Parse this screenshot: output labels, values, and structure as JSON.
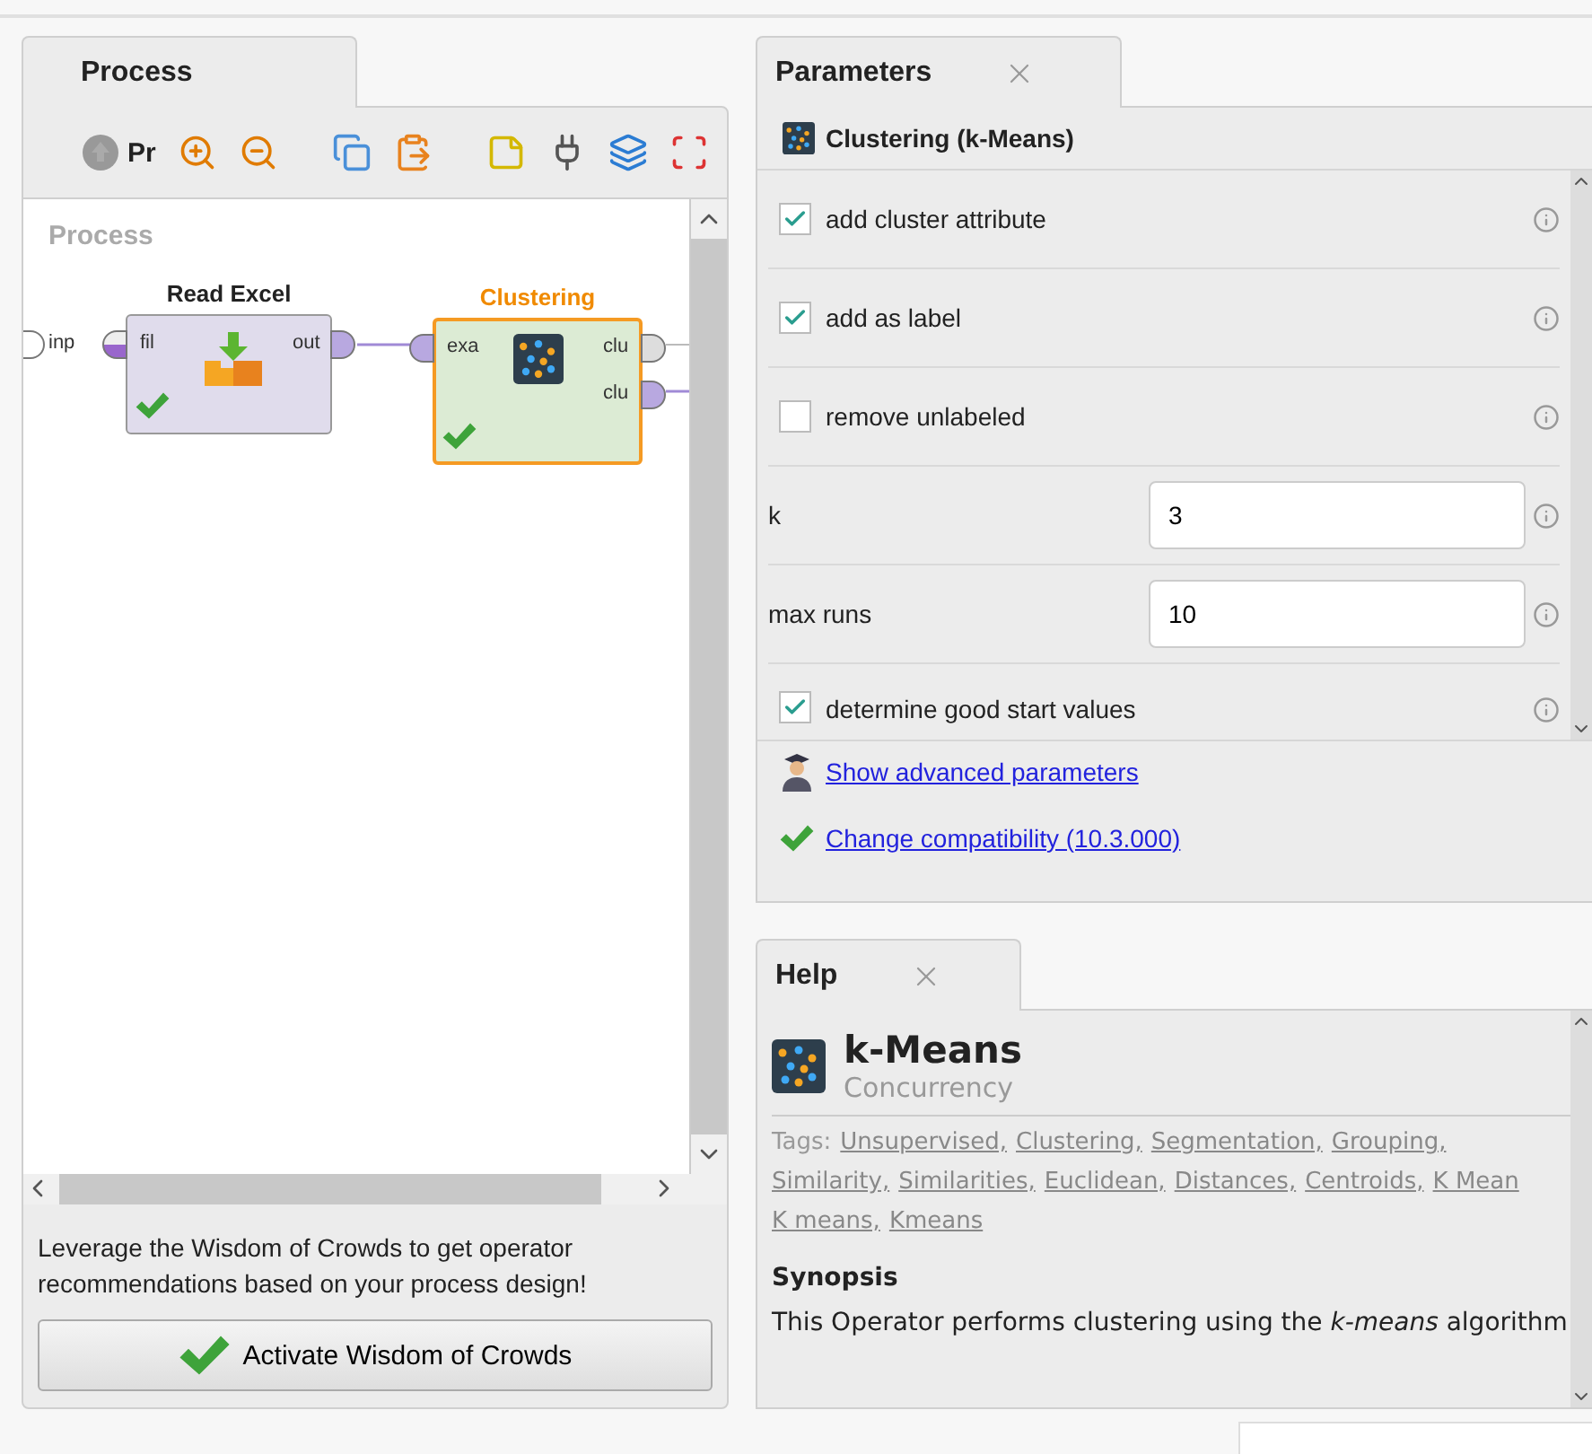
{
  "process_panel": {
    "tab": {
      "label": "Process",
      "selected": true
    },
    "toolbar": {
      "label": "Pr"
    },
    "canvas": {
      "title": "Process",
      "process_port": "inp",
      "operators": [
        {
          "name": "Read Excel",
          "kind": "read",
          "selected": false,
          "ok": true,
          "inputs": [
            "fil"
          ],
          "outputs": [
            "out"
          ]
        },
        {
          "name": "Clustering",
          "kind": "cluster",
          "selected": true,
          "ok": true,
          "inputs": [
            "exa"
          ],
          "outputs": [
            "clu",
            "clu"
          ]
        }
      ]
    },
    "recommendation": "Leverage the Wisdom of Crowds to get operator recommendations based on your process design!",
    "button": "Activate Wisdom of Crowds"
  },
  "parameters_panel": {
    "tab": {
      "label": "Parameters",
      "selected": true
    },
    "operator": "Clustering (k-Means)",
    "params": [
      {
        "kind": "checkbox",
        "label": "add cluster attribute",
        "checked": true
      },
      {
        "kind": "checkbox",
        "label": "add as label",
        "checked": true
      },
      {
        "kind": "checkbox",
        "label": "remove unlabeled",
        "checked": false
      },
      {
        "kind": "number",
        "label": "k",
        "value": "3"
      },
      {
        "kind": "number",
        "label": "max runs",
        "value": "10"
      },
      {
        "kind": "checkbox",
        "label": "determine good start values",
        "checked": true
      }
    ],
    "advanced_link": "Show advanced parameters",
    "compat_link": "Change compatibility (10.3.000)"
  },
  "help_panel": {
    "tab": {
      "label": "Help",
      "selected": true
    },
    "title": "k-Means",
    "subtitle": "Concurrency",
    "tags_label": "Tags:",
    "tags": [
      "Unsupervised,",
      "Clustering,",
      "Segmentation,",
      "Grouping,",
      "Similarity,",
      "Similarities,",
      "Euclidean,",
      "Distances,",
      "Centroids,",
      "K Mean",
      "K means,",
      "Kmeans"
    ],
    "section": "Synopsis",
    "synopsis": "This Operator performs clustering using the *k-means* algorithm"
  }
}
